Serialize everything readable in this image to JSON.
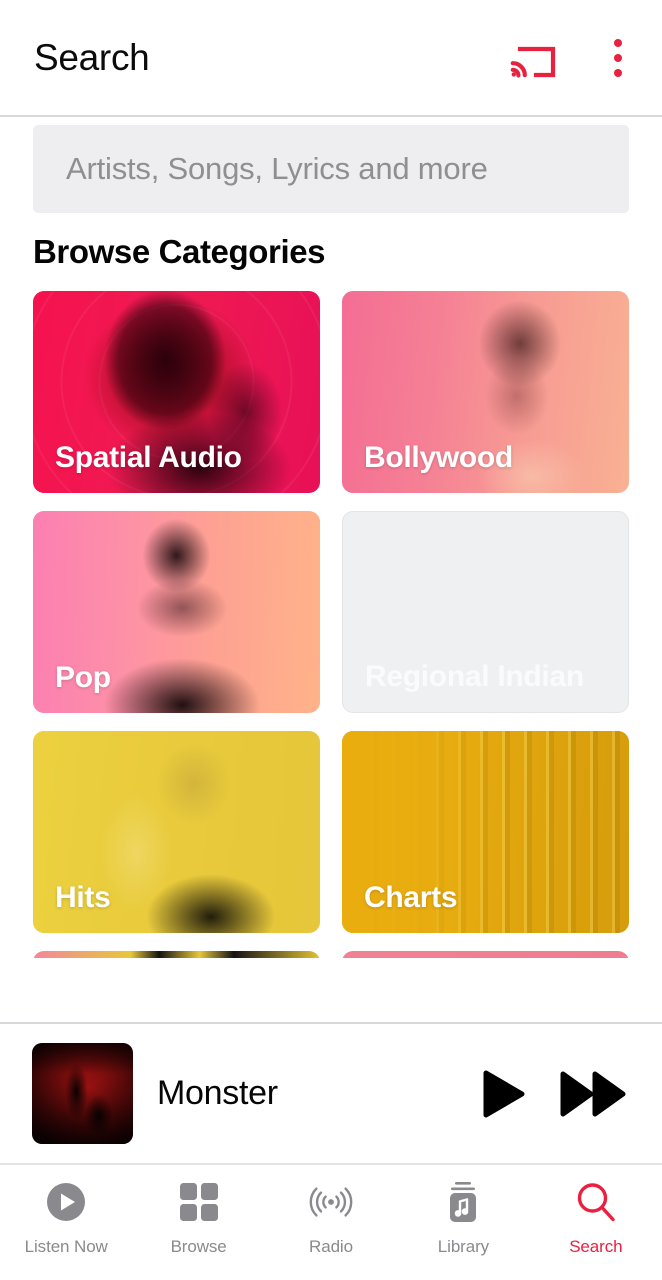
{
  "appbar": {
    "title": "Search",
    "cast_icon": "cast-icon",
    "overflow_icon": "more-vertical-icon"
  },
  "search": {
    "placeholder": "Artists, Songs, Lyrics and more",
    "value": ""
  },
  "browse": {
    "section_title": "Browse Categories",
    "tiles": [
      {
        "label": "Spatial Audio",
        "art": "art-spatial",
        "loaded": true
      },
      {
        "label": "Bollywood",
        "art": "art-bollywood",
        "loaded": true
      },
      {
        "label": "Pop",
        "art": "art-pop",
        "loaded": true
      },
      {
        "label": "Regional Indian",
        "art": "",
        "loaded": false
      },
      {
        "label": "Hits",
        "art": "art-hits",
        "loaded": true
      },
      {
        "label": "Charts",
        "art": "art-charts",
        "loaded": true
      }
    ]
  },
  "miniplayer": {
    "track_title": "Monster",
    "album_art": "album-art-monster",
    "play_icon": "play-icon",
    "next_icon": "fast-forward-icon"
  },
  "bottomnav": {
    "items": [
      {
        "label": "Listen Now",
        "icon": "play-circle-icon",
        "active": false
      },
      {
        "label": "Browse",
        "icon": "grid-icon",
        "active": false
      },
      {
        "label": "Radio",
        "icon": "radio-waves-icon",
        "active": false
      },
      {
        "label": "Library",
        "icon": "library-music-icon",
        "active": false
      },
      {
        "label": "Search",
        "icon": "search-icon",
        "active": true
      }
    ]
  },
  "colors": {
    "accent": "#ea2040",
    "inactive": "#8a8a8e",
    "search_field_bg": "#eeeef0",
    "placeholder_text": "#8e8e93"
  }
}
